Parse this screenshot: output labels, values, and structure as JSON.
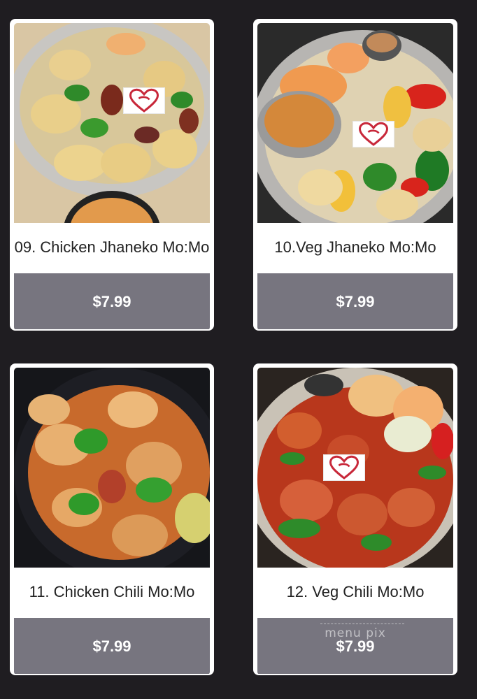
{
  "items": [
    {
      "name": "09. Chicken Jhaneko Mo:Mo",
      "price": "$7.99"
    },
    {
      "name": "10.Veg Jhaneko Mo:Mo",
      "price": "$7.99"
    },
    {
      "name": "11. Chicken Chili Mo:Mo",
      "price": "$7.99"
    },
    {
      "name": "12. Veg Chili Mo:Mo",
      "price": "$7.99"
    }
  ],
  "watermark": "menu pix",
  "icons": {
    "badge": "heart-logo-icon"
  },
  "colors": {
    "background": "#1f1d21",
    "price_bar": "#77757f",
    "logo": "#c8283a"
  }
}
